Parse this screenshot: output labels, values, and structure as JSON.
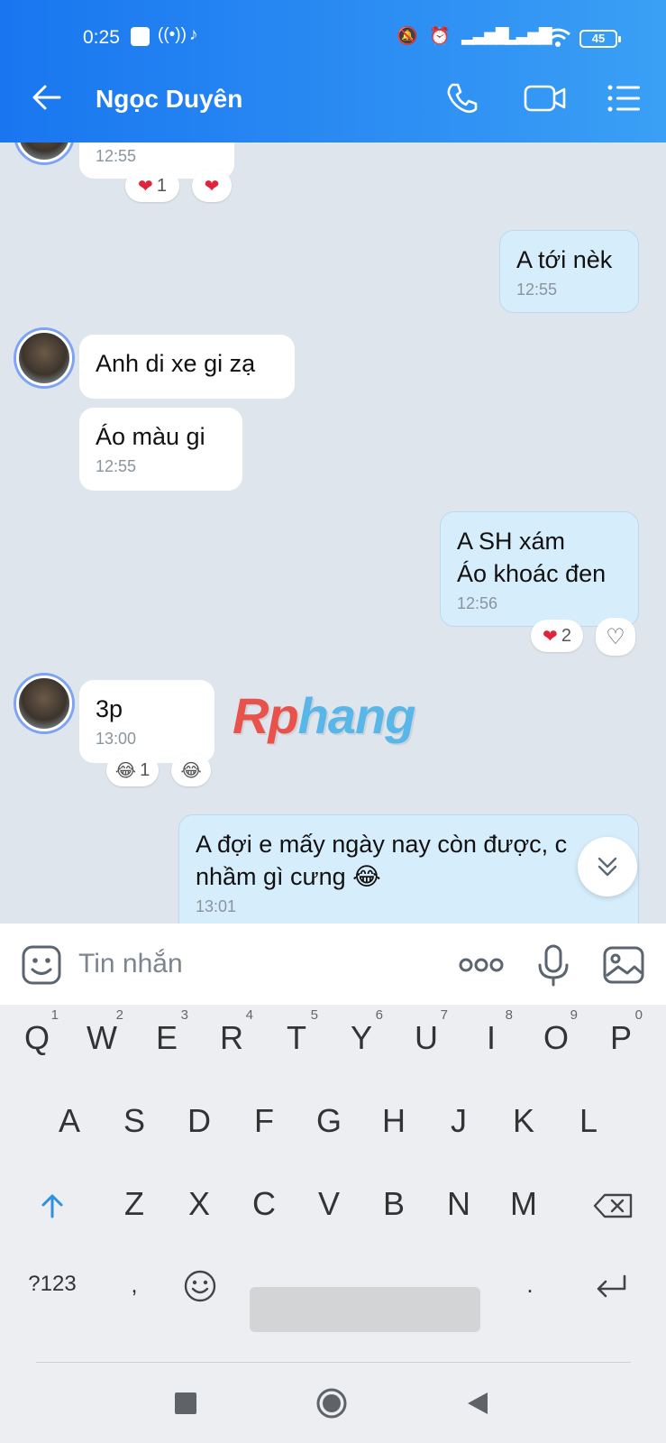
{
  "status_bar": {
    "time": "0:25",
    "battery": "45"
  },
  "header": {
    "contact_name": "Ngọc Duyên"
  },
  "messages": [
    {
      "dir": "in",
      "time": "12:55",
      "react_count": "1"
    },
    {
      "dir": "out",
      "text": "A tới nèk",
      "time": "12:55"
    },
    {
      "dir": "in",
      "text": "Anh di xe gi zạ"
    },
    {
      "dir": "in",
      "text": "Áo màu gi",
      "time": "12:55"
    },
    {
      "dir": "out",
      "line1": "A SH xám",
      "line2": "Áo khoác đen",
      "time": "12:56",
      "react_count": "2"
    },
    {
      "dir": "in",
      "text": "3p",
      "time": "13:00",
      "react_count": "1"
    },
    {
      "dir": "out",
      "line1": "A đợi e mấy ngày nay còn được, c",
      "line2": "nhầm gì cưng 😂",
      "time": "13:01"
    }
  ],
  "watermark": {
    "part1": "Rp",
    "part2": "hang"
  },
  "input": {
    "placeholder": "Tin nhắn"
  },
  "keyboard": {
    "row1": [
      "Q",
      "W",
      "E",
      "R",
      "T",
      "Y",
      "U",
      "I",
      "O",
      "P"
    ],
    "row1_nums": [
      "1",
      "2",
      "3",
      "4",
      "5",
      "6",
      "7",
      "8",
      "9",
      "0"
    ],
    "row2": [
      "A",
      "S",
      "D",
      "F",
      "G",
      "H",
      "J",
      "K",
      "L"
    ],
    "row3": [
      "Z",
      "X",
      "C",
      "V",
      "B",
      "N",
      "M"
    ],
    "symbols_key": "?123",
    "comma": ",",
    "period": "."
  },
  "colors": {
    "header": "#1976f0",
    "outgoing_bubble": "#d6edfb",
    "incoming_bubble": "#ffffff",
    "chat_bg": "#dfe5ec"
  }
}
